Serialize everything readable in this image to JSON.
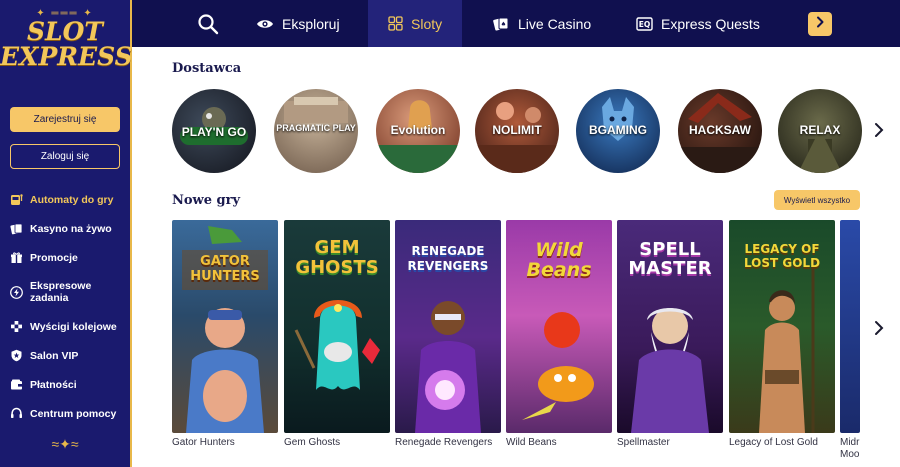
{
  "brand": {
    "logo_line1": "SLOT",
    "logo_line2": "EXPRESS"
  },
  "sidebar": {
    "register_label": "Zarejestruj się",
    "login_label": "Zaloguj się",
    "items": [
      {
        "label": "Automaty do gry",
        "icon": "slot-machine-icon",
        "active": true
      },
      {
        "label": "Kasyno na żywo",
        "icon": "cards-icon"
      },
      {
        "label": "Promocje",
        "icon": "gift-icon"
      },
      {
        "label": "Ekspresowe zadania",
        "icon": "lightning-icon"
      },
      {
        "label": "Wyścigi kolejowe",
        "icon": "race-icon"
      },
      {
        "label": "Salon VIP",
        "icon": "shield-icon"
      },
      {
        "label": "Płatności",
        "icon": "wallet-icon"
      },
      {
        "label": "Centrum pomocy",
        "icon": "headset-icon"
      }
    ]
  },
  "topbar": {
    "items": [
      {
        "label": "Eksploruj",
        "icon": "eye-icon"
      },
      {
        "label": "Sloty",
        "icon": "grid-icon",
        "active": true
      },
      {
        "label": "Live Casino",
        "icon": "cards-icon"
      },
      {
        "label": "Express Quests",
        "icon": "quest-icon"
      }
    ]
  },
  "providers": {
    "title": "Dostawca",
    "items": [
      "PLAY'N GO",
      "PRAGMATIC PLAY",
      "Evolution",
      "NOLIMIT",
      "BGAMING",
      "HACKSAW",
      "RELAX"
    ]
  },
  "new_games": {
    "title": "Nowe gry",
    "view_all_label": "Wyświetl wszystko",
    "items": [
      {
        "name": "Gator Hunters",
        "art": "GATOR HUNTERS"
      },
      {
        "name": "Gem Ghosts",
        "art": "GEM GHOSTS"
      },
      {
        "name": "Renegade Revengers",
        "art": "RENEGADE REVENGERS"
      },
      {
        "name": "Wild Beans",
        "art": "Wild Beans"
      },
      {
        "name": "Spellmaster",
        "art": "SPELL MASTER"
      },
      {
        "name": "Legacy of Lost Gold",
        "art": "LEGACY OF LOST GOLD"
      },
      {
        "name": "Midr Moo",
        "art": ""
      }
    ]
  },
  "colors": {
    "navy": "#1a1a6e",
    "topbar": "#10104f",
    "gold": "#f7c768",
    "accent_text": "#f2c75a"
  }
}
